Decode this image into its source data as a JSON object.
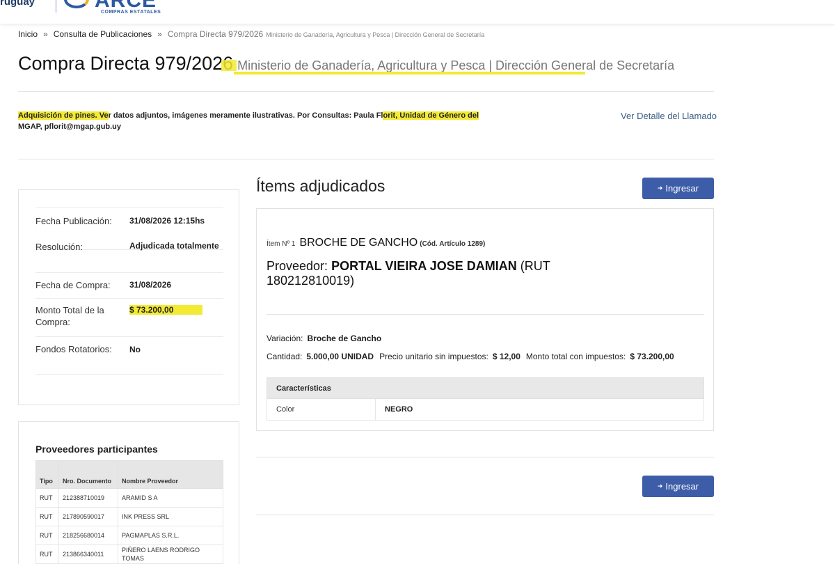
{
  "header": {
    "country": "ruguay",
    "logo_text": "ARCE",
    "logo_sub": "COMPRAS ESTATALES"
  },
  "breadcrumb": {
    "home": "Inicio",
    "section": "Consulta de Publicaciones",
    "current": "Compra Directa 979/2026",
    "current_sub": "Ministerio de Ganadería, Agricultura y Pesca | Dirección General de Secretaría"
  },
  "page": {
    "title": "Compra Directa 979/2026",
    "subtitle": "Ministerio de Ganadería, Agricultura y Pesca | Dirección General de Secretaría"
  },
  "description": {
    "part1": "Adquisición de pines. Ve",
    "part2": "r datos adjuntos, imágenes meramente ilustrativas. Por Consultas: Paula Fl",
    "part3": "orit, Unidad de Género del",
    "part4": " MGAP, pflorit@mgap.gub.uy"
  },
  "link_detalle": "Ver Detalle del Llamado",
  "info": {
    "fecha_publicacion": {
      "label": "Fecha Publicación:",
      "value": "31/08/2026 12:15hs"
    },
    "resolucion": {
      "label": "Resolución:",
      "value": "Adjudicada totalmente"
    },
    "fecha_compra": {
      "label": "Fecha de Compra:",
      "value": "31/08/2026"
    },
    "monto_total": {
      "label": "Monto Total de la Compra:",
      "value": "$ 73.200,00"
    },
    "fondos": {
      "label": "Fondos Rotatorios:",
      "value": "No"
    }
  },
  "proveedores": {
    "title": "Proveedores participantes",
    "columns": [
      "Tipo",
      "Nro. Documento",
      "Nombre Proveedor"
    ],
    "rows": [
      [
        "RUT",
        "212388710019",
        "ARAMID S A"
      ],
      [
        "RUT",
        "217890590017",
        "INK PRESS SRL"
      ],
      [
        "RUT",
        "218256680014",
        "PAGMAPLAS S.R.L."
      ],
      [
        "RUT",
        "213866340011",
        "PIÑERO LAENS RODRIGO TOMAS"
      ]
    ]
  },
  "items": {
    "title": "Ítems adjudicados",
    "button_label": "Ingresar",
    "item_no": "Ítem Nº 1",
    "item_name": "BROCHE DE GANCHO",
    "item_cod": "(Cód. Artículo 1289)",
    "proveedor_label": "Proveedor:",
    "proveedor_name": "PORTAL VIEIRA JOSE DAMIAN",
    "proveedor_rut": "(RUT 180212810019)",
    "variacion_label": "Variación:",
    "variacion_value": "Broche de Gancho",
    "cantidad_label": "Cantidad:",
    "cantidad_value": "5.000,00 UNIDAD",
    "precio_label": "Precio unitario sin impuestos:",
    "precio_value": "$ 12,00",
    "monto_label": "Monto total con impuestos:",
    "monto_value": "$ 73.200,00",
    "caracteristicas_header": "Características",
    "caracteristicas": [
      {
        "name": "Color",
        "value": "NEGRO"
      }
    ]
  },
  "colors": {
    "highlight": "#f3ea34",
    "primary_button": "#3d5da8",
    "link": "#3a5e86"
  }
}
